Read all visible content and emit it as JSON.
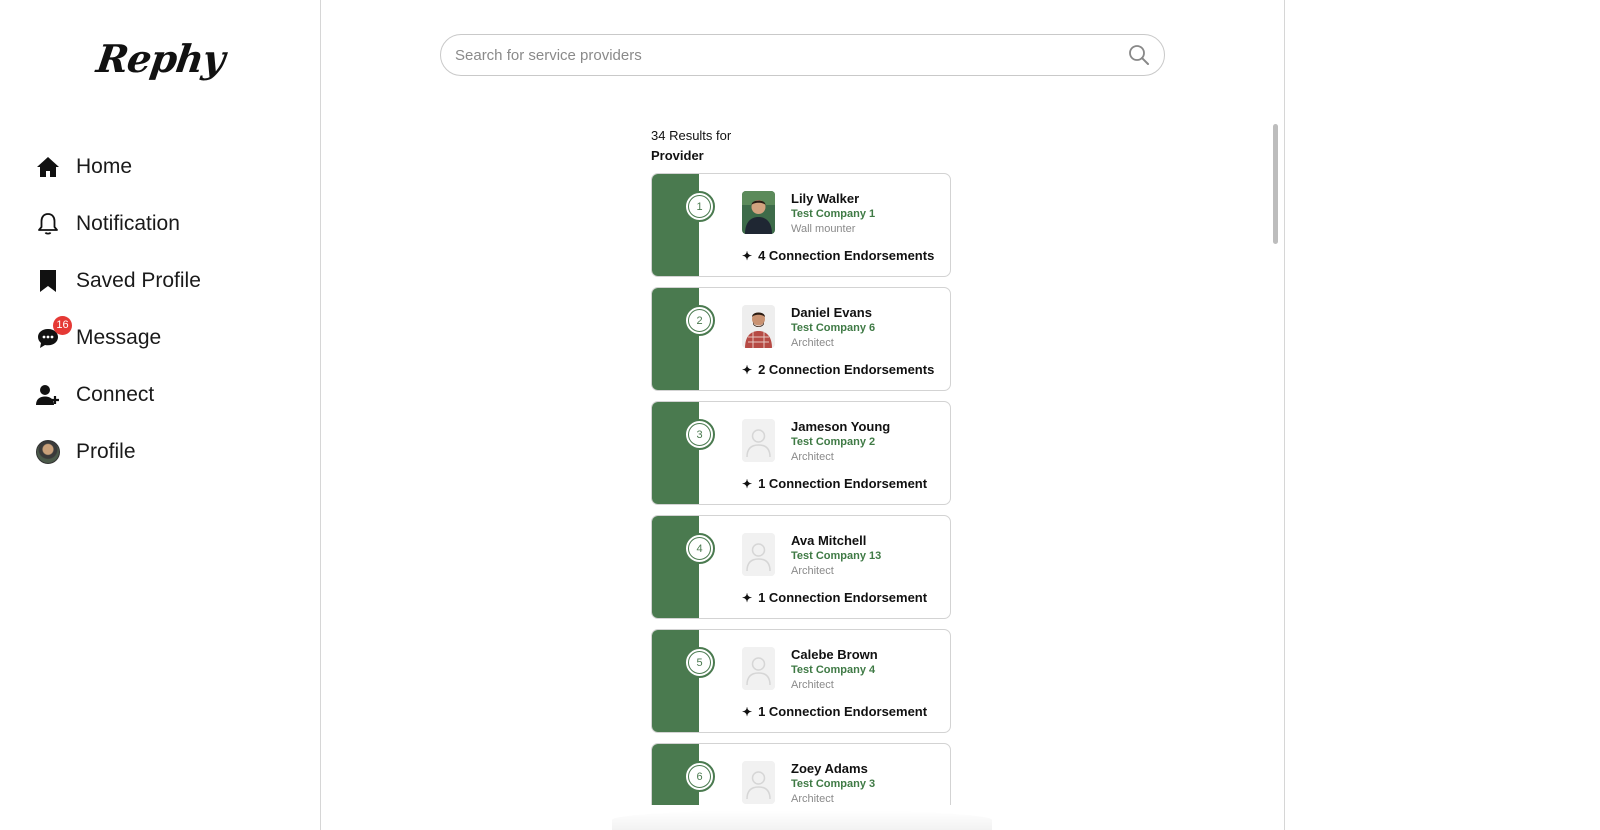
{
  "app": {
    "logo": "Rephy"
  },
  "sidebar": {
    "items": [
      {
        "label": "Home",
        "icon": "home-icon"
      },
      {
        "label": "Notification",
        "icon": "bell-icon"
      },
      {
        "label": "Saved Profile",
        "icon": "bookmark-icon"
      },
      {
        "label": "Message",
        "icon": "chat-icon",
        "badge": "16"
      },
      {
        "label": "Connect",
        "icon": "add-user-icon"
      },
      {
        "label": "Profile",
        "icon": "avatar"
      }
    ]
  },
  "search": {
    "placeholder": "Search for service providers",
    "value": ""
  },
  "results": {
    "count_text": "34 Results for",
    "query": "Provider"
  },
  "colors": {
    "accent": "#4a7a4f",
    "company": "#3f7a45",
    "badge": "#e53935"
  },
  "providers": [
    {
      "rank": "1",
      "name": "Lily Walker",
      "company": "Test Company 1",
      "role": "Wall mounter",
      "endorsements": "4 Connection Endorsements",
      "photo": "man-portrait-1"
    },
    {
      "rank": "2",
      "name": "Daniel Evans",
      "company": "Test Company 6",
      "role": "Architect",
      "endorsements": "2 Connection Endorsements",
      "photo": "man-portrait-2"
    },
    {
      "rank": "3",
      "name": "Jameson Young",
      "company": "Test Company 2",
      "role": "Architect",
      "endorsements": "1 Connection Endorsement",
      "photo": "placeholder"
    },
    {
      "rank": "4",
      "name": "Ava Mitchell",
      "company": "Test Company 13",
      "role": "Architect",
      "endorsements": "1 Connection Endorsement",
      "photo": "placeholder"
    },
    {
      "rank": "5",
      "name": "Calebe Brown",
      "company": "Test Company 4",
      "role": "Architect",
      "endorsements": "1 Connection Endorsement",
      "photo": "placeholder"
    },
    {
      "rank": "6",
      "name": "Zoey Adams",
      "company": "Test Company 3",
      "role": "Architect",
      "endorsements": "",
      "photo": "placeholder"
    }
  ]
}
